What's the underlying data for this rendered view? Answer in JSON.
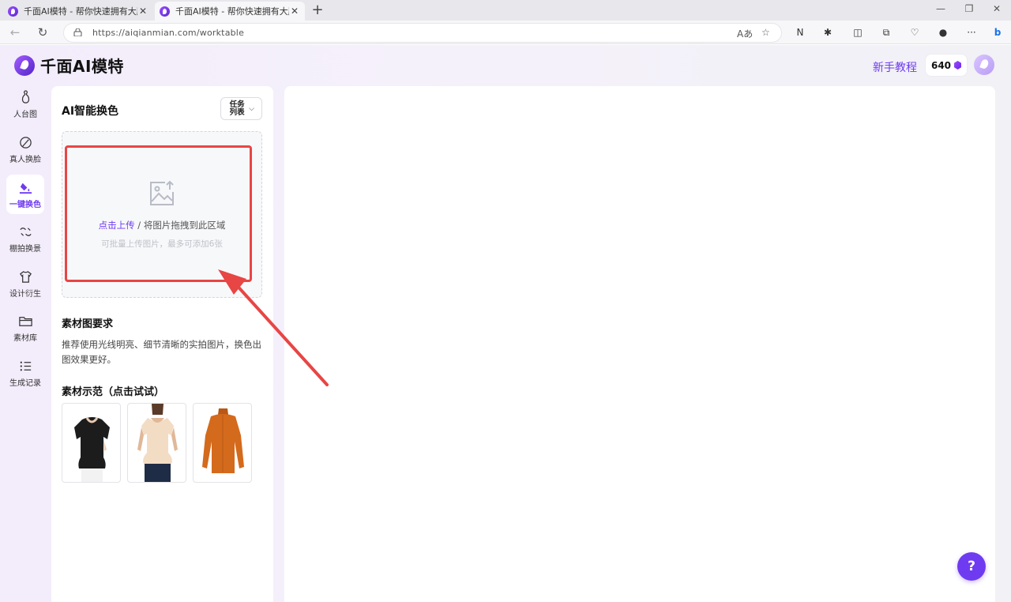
{
  "browser": {
    "tabs": [
      {
        "title": "千面AI模特 - 帮你快速拥有大牌同款",
        "close": "✕"
      },
      {
        "title": "千面AI模特 - 帮你快速拥有大牌同款",
        "close": "✕"
      }
    ],
    "new_tab": "+",
    "url": "https://aiqianmian.com/worktable"
  },
  "app": {
    "logo_text": "千面AI模特",
    "header": {
      "tutorial": "新手教程",
      "credits": "640"
    },
    "sidebar": {
      "items": [
        {
          "label": "人台图",
          "icon": "mannequin-icon",
          "active": false
        },
        {
          "label": "真人换脸",
          "icon": "face-swap-icon",
          "active": false
        },
        {
          "label": "一键换色",
          "icon": "paint-bucket-icon",
          "active": true
        },
        {
          "label": "棚拍换景",
          "icon": "scene-swap-icon",
          "active": false
        },
        {
          "label": "设计衍生",
          "icon": "shirt-icon",
          "active": false
        },
        {
          "label": "素材库",
          "icon": "folder-icon",
          "active": false
        },
        {
          "label": "生成记录",
          "icon": "list-icon",
          "active": false
        }
      ]
    },
    "panel": {
      "title": "AI智能换色",
      "task_button_line1": "任务",
      "task_button_line2": "列表",
      "upload": {
        "link": "点击上传",
        "separator": " / ",
        "drag_text": "将图片拖拽到此区域",
        "hint": "可批量上传图片，最多可添加6张"
      },
      "requirements_title": "素材图要求",
      "requirements_text": "推荐使用光线明亮、细节清晰的实拍图片，换色出图效果更好。",
      "examples_title": "素材示范（点击试试）",
      "examples": [
        {
          "name": "black-blouse",
          "color": "#1c1c1c"
        },
        {
          "name": "cream-peplum-top",
          "color": "#f3dcc4"
        },
        {
          "name": "orange-knit-top",
          "color": "#d46a1c"
        }
      ]
    },
    "help": "?"
  },
  "annotation": {
    "highlight_color": "#e84545"
  }
}
